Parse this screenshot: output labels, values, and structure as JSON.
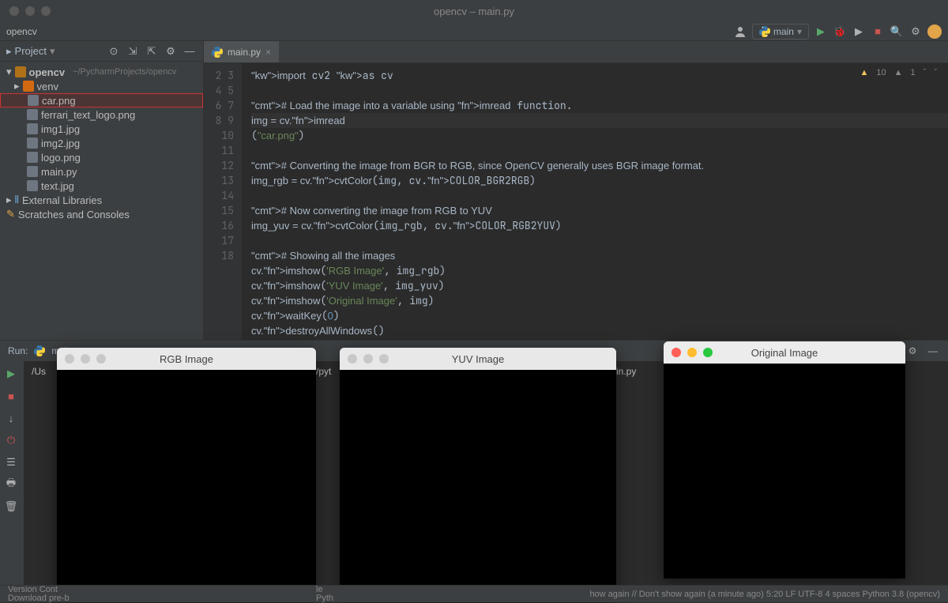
{
  "window": {
    "title": "opencv – main.py"
  },
  "breadcrumb": "opencv",
  "run_config": {
    "label": "main"
  },
  "toolbar_icons": [
    "rerun",
    "debug",
    "run",
    "stop",
    "search",
    "more",
    "avatar"
  ],
  "inspection": {
    "warnings": "10",
    "weak": "1"
  },
  "project_panel": {
    "title": "Project",
    "root": {
      "name": "opencv",
      "path": "~/PycharmProjects/opencv"
    },
    "items": [
      {
        "name": "venv",
        "type": "folder"
      },
      {
        "name": "car.png",
        "type": "file",
        "highlight": true
      },
      {
        "name": "ferrari_text_logo.png",
        "type": "file"
      },
      {
        "name": "img1.jpg",
        "type": "file"
      },
      {
        "name": "img2.jpg",
        "type": "file"
      },
      {
        "name": "logo.png",
        "type": "file"
      },
      {
        "name": "main.py",
        "type": "file"
      },
      {
        "name": "text.jpg",
        "type": "file"
      }
    ],
    "external": "External Libraries",
    "scratches": "Scratches and Consoles"
  },
  "editor": {
    "tab": "main.py",
    "active_line": 5,
    "lines": [
      "import cv2 as cv",
      "",
      "# Load the image into a variable using imread function.",
      "img = cv.imread(\"car.png\")",
      "",
      "# Converting the image from BGR to RGB, since OpenCV generally uses BGR image format.",
      "img_rgb = cv.cvtColor(img, cv.COLOR_BGR2RGB)",
      "",
      "# Now converting the image from RGB to YUV",
      "img_yuv = cv.cvtColor(img_rgb, cv.COLOR_RGB2YUV)",
      "",
      "# Showing all the images",
      "cv.imshow('RGB Image', img_rgb)",
      "cv.imshow('YUV Image', img_yuv)",
      "cv.imshow('Original Image', img)",
      "cv.waitKey(0)",
      "cv.destroyAllWindows()"
    ]
  },
  "run_tab": {
    "label": "main",
    "output": "/Us",
    "output_mid": "/pyt",
    "output_end": "in.py"
  },
  "image_windows": [
    {
      "title": "RGB Image",
      "active": false
    },
    {
      "title": "YUV Image",
      "active": false
    },
    {
      "title": "Original Image",
      "active": true
    }
  ],
  "statusbar": {
    "left1": "Version Cont",
    "left2": "Download pre-b",
    "mid1": "le",
    "mid2": "Pyth",
    "right": "how again // Don't show again (a minute ago)   5:20  LF  UTF-8  4 spaces  Python 3.8 (opencv)"
  }
}
